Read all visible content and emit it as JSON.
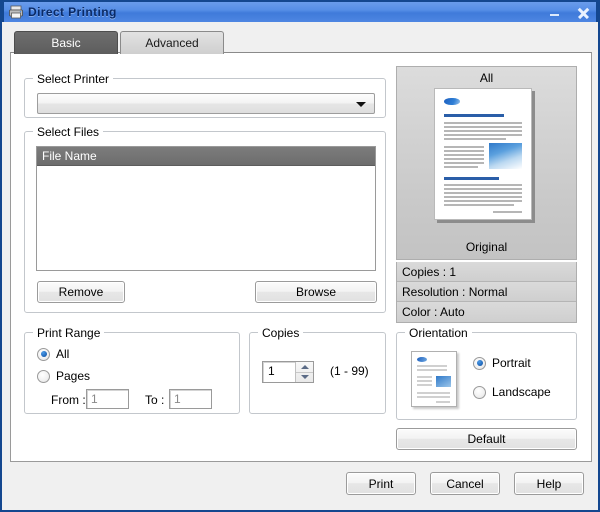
{
  "window": {
    "title": "Direct Printing",
    "icon": "printer-icon",
    "minimize_label": "Minimize",
    "close_label": "Close",
    "titlebar_color": "#4e86e2",
    "border_color": "#14478f"
  },
  "tabs": [
    {
      "label": "Basic",
      "selected": true
    },
    {
      "label": "Advanced",
      "selected": false
    }
  ],
  "select_printer": {
    "legend": "Select Printer",
    "value": "",
    "placeholder": ""
  },
  "select_files": {
    "legend": "Select Files",
    "column_header": "File Name",
    "rows": [],
    "remove_label": "Remove",
    "browse_label": "Browse"
  },
  "print_range": {
    "legend": "Print Range",
    "options": [
      {
        "label": "All",
        "checked": true
      },
      {
        "label": "Pages",
        "checked": false
      }
    ],
    "from_label": "From :",
    "from_value": "1",
    "to_label": "To :",
    "to_value": "1"
  },
  "copies": {
    "legend": "Copies",
    "value": "1",
    "hint": "(1 - 99)"
  },
  "orientation": {
    "legend": "Orientation",
    "options": [
      {
        "label": "Portrait",
        "checked": true
      },
      {
        "label": "Landscape",
        "checked": false
      }
    ]
  },
  "preview": {
    "title": "All",
    "caption": "Original",
    "info": [
      "Copies : 1",
      "Resolution : Normal",
      "Color : Auto"
    ]
  },
  "buttons": {
    "default_label": "Default",
    "print_label": "Print",
    "cancel_label": "Cancel",
    "help_label": "Help"
  }
}
